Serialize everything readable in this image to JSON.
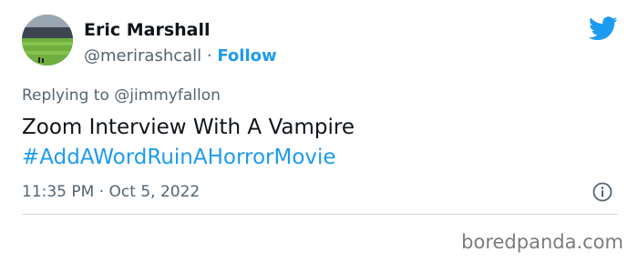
{
  "user": {
    "name": "Eric Marshall",
    "handle": "@merirashcall",
    "separator": "·",
    "follow_label": "Follow"
  },
  "reply": {
    "text": "Replying to @jimmyfallon"
  },
  "tweet": {
    "line1": "Zoom Interview With A Vampire",
    "hashtag": "#AddAWordRuinAHorrorMovie"
  },
  "meta": {
    "timestamp": "11:35 PM · Oct 5, 2022"
  },
  "watermark": "boredpanda.com",
  "colors": {
    "twitter_blue": "#1d9bf0",
    "text_primary": "#0f1419",
    "text_secondary": "#536471"
  },
  "icons": {
    "brand": "twitter-bird-icon",
    "info": "info-icon"
  }
}
